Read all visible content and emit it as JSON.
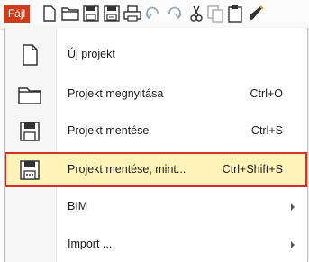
{
  "toolbar": {
    "file_tab_label": "Fájl",
    "icons": [
      "new-file-icon",
      "open-folder-icon",
      "save-icon",
      "save-as-icon",
      "print-icon",
      "undo-icon",
      "redo-icon",
      "cut-icon",
      "copy-icon",
      "paste-icon",
      "format-brush-icon"
    ]
  },
  "menu": {
    "items": [
      {
        "label": "Új projekt",
        "shortcut": "",
        "icon": "new-file-icon",
        "submenu": false
      },
      {
        "label": "Projekt megnyitása",
        "shortcut": "Ctrl+O",
        "icon": "open-folder-icon",
        "submenu": false
      },
      {
        "label": "Projekt mentése",
        "shortcut": "Ctrl+S",
        "icon": "save-icon",
        "submenu": false
      },
      {
        "label": "Projekt mentése, mint...",
        "shortcut": "Ctrl+Shift+S",
        "icon": "save-as-icon",
        "submenu": false,
        "highlighted": true
      },
      {
        "label": "BIM",
        "shortcut": "",
        "icon": "",
        "submenu": true
      },
      {
        "label": "Import ...",
        "shortcut": "",
        "icon": "",
        "submenu": true
      }
    ]
  },
  "colors": {
    "file_tab_bg": "#cf3c17",
    "highlight_bg": "#fff3b8",
    "highlight_border": "#d9302a"
  }
}
